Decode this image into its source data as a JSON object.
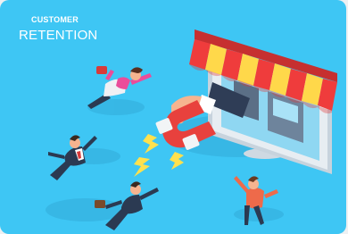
{
  "illustration": {
    "eyebrow": "CUSTOMER",
    "title": "RETENTION",
    "colors": {
      "background": "#3ec6f4",
      "awning_red": "#ef3c3c",
      "awning_yellow": "#ffd84a",
      "magnet_red": "#e8413d",
      "monitor": "#dfe7ee"
    },
    "icons": [
      "storefront-monitor-icon",
      "magnet-icon",
      "hand-icon",
      "lightning-icon",
      "flying-person-icon"
    ]
  }
}
